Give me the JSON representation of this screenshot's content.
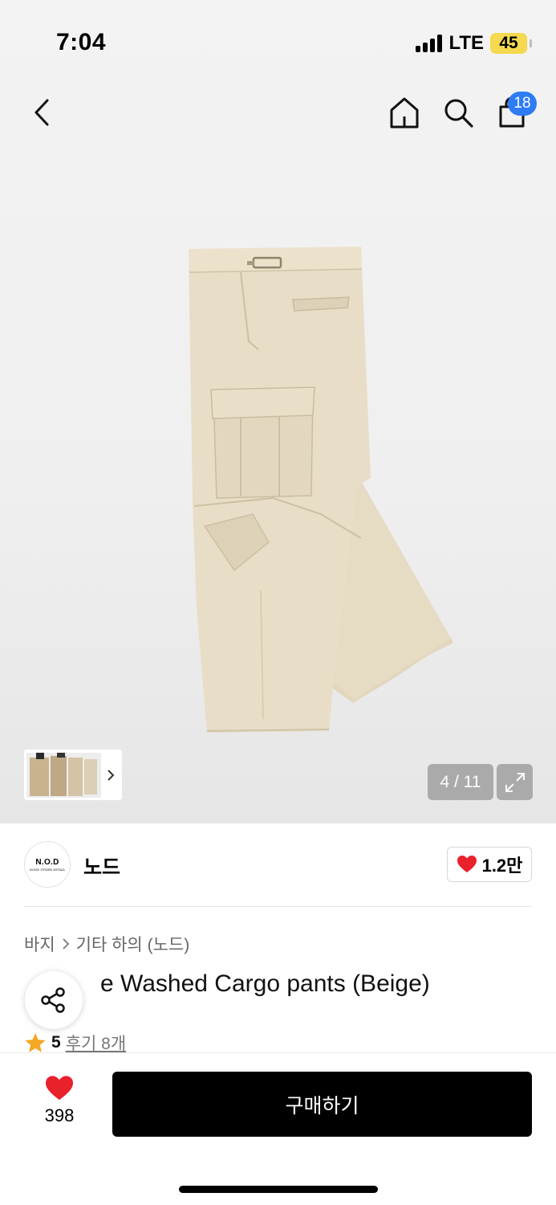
{
  "status_bar": {
    "time": "7:04",
    "network": "LTE",
    "battery": "45"
  },
  "top_nav": {
    "cart_count": "18",
    "icons": [
      "back-arrow-icon",
      "home-icon",
      "search-icon",
      "shopping-bag-icon"
    ]
  },
  "gallery": {
    "counter": "4 / 11",
    "current_index": 4,
    "total": 11
  },
  "brand": {
    "logo_line1": "N.O.D",
    "logo_line2": "NONE OTHER DETAIL",
    "name": "노드",
    "like_count": "1.2만"
  },
  "breadcrumb": {
    "category": "바지",
    "subcategory": "기타 하의 (노드)"
  },
  "product": {
    "title": "e Washed Cargo pants (Beige)",
    "rating": "5",
    "reviews": "후기 8개"
  },
  "bottom": {
    "wish_count": "398",
    "buy_label": "구매하기"
  },
  "colors": {
    "accent_blue": "#2d7cf6",
    "heart_red": "#e8212b",
    "star_orange": "#f5a623",
    "battery_yellow": "#f5d94e"
  }
}
